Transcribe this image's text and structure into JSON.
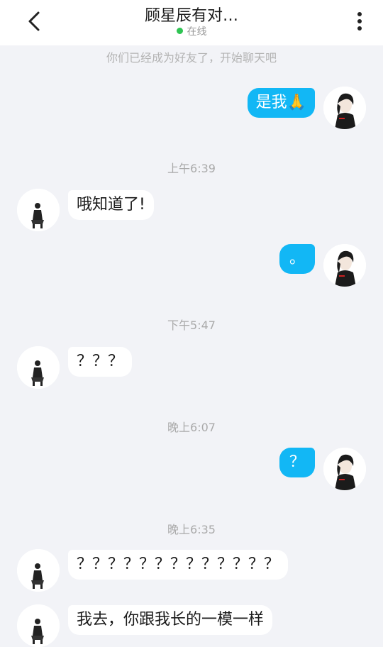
{
  "header": {
    "title": "顾星辰有对…",
    "status": "在线"
  },
  "system_note": "你们已经成为好友了，开始聊天吧",
  "messages": {
    "m1": {
      "text": "是我",
      "emoji": "🙏"
    },
    "t1": "上午6:39",
    "m2": {
      "text": "哦知道了!"
    },
    "m3": {
      "text": "。"
    },
    "t2": "下午5:47",
    "m4": {
      "text": "？？？"
    },
    "t3": "晚上6:07",
    "m5": {
      "text": "？"
    },
    "t4": "晚上6:35",
    "m6": {
      "text": "？？？？？？？？？？？？？"
    },
    "m7": {
      "text": "我去，你跟我长的一模一样"
    }
  },
  "colors": {
    "outgoing_bubble": "#12b7f5",
    "incoming_bubble": "#ffffff",
    "background": "#f2f3f7",
    "online_dot": "#2fc453"
  },
  "icons": {
    "back": "chevron-left-icon",
    "more": "vertical-dots-icon"
  }
}
